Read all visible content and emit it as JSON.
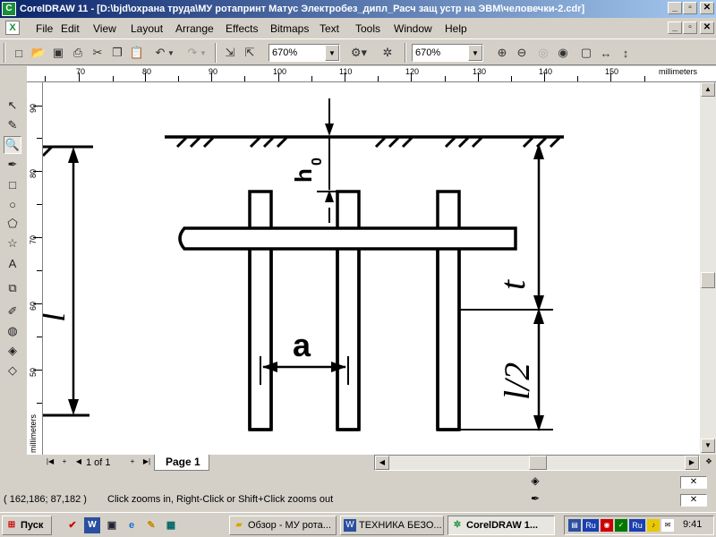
{
  "window": {
    "title": "CorelDRAW 11 - [D:\\bjd\\охрана труда\\МУ ротапринт Матус Электробез_дипл_Расч защ устр на ЭВМ\\человечки-2.cdr]",
    "minimize": "_",
    "restore": "▫",
    "close": "✕"
  },
  "menu": {
    "items": [
      "File",
      "Edit",
      "View",
      "Layout",
      "Arrange",
      "Effects",
      "Bitmaps",
      "Text",
      "Tools",
      "Window",
      "Help"
    ]
  },
  "toolbar": {
    "zoom_combo_1": "670%",
    "zoom_combo_2": "670%"
  },
  "ruler": {
    "units": "millimeters",
    "h_labels": [
      "70",
      "80",
      "90",
      "100",
      "110",
      "120",
      "130",
      "140",
      "150"
    ],
    "v_labels": [
      "90",
      "80",
      "70",
      "60",
      "50"
    ]
  },
  "drawing": {
    "label_h0": "h",
    "label_h0_sub": "0",
    "label_t": "t",
    "label_a": "a",
    "label_l": "l",
    "label_l2": "l/2"
  },
  "page_nav": {
    "position": "1 of 1",
    "page_tab": "Page 1"
  },
  "status": {
    "coords": "( 162,186; 87,182 )",
    "hint": "Click zooms in, Right-Click or Shift+Click zooms out"
  },
  "taskbar": {
    "start": "Пуск",
    "tasks": [
      "Обзор - МУ рота...",
      "ТЕХНИКА БЕЗО...",
      "CorelDRAW 1..."
    ],
    "clock": "9:41",
    "lang": "Ru"
  },
  "colors": {
    "title_start": "#0a246a",
    "title_end": "#a6caf0",
    "chrome": "#d4d0c8"
  }
}
